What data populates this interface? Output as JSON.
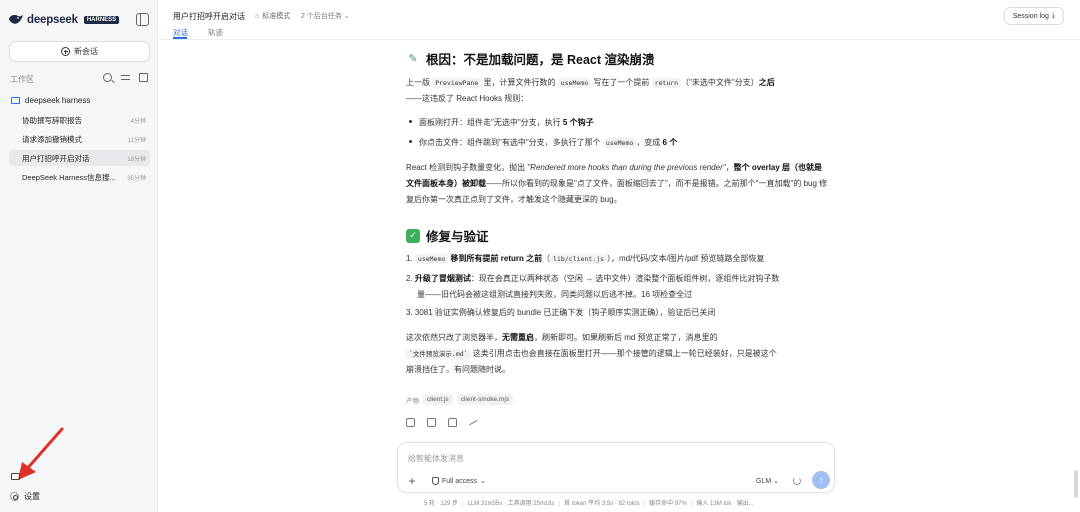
{
  "sidebar": {
    "logo_text": "deepseek",
    "logo_badge": "HARNESS",
    "new_chat_label": "新会话",
    "workspace_label": "工作区",
    "folder_name": "deepseek harness",
    "sessions": [
      {
        "title": "协助撰写辞职报告",
        "time": "4分钟"
      },
      {
        "title": "请求添加撤销模式",
        "time": "11分钟"
      },
      {
        "title": "用户打招呼开启对话",
        "time": "18分钟"
      },
      {
        "title": "DeepSeek Harness信息搜...",
        "time": "35分钟"
      }
    ],
    "active_session_index": 2,
    "settings_label": "设置"
  },
  "header": {
    "title": "用户打招呼开启对话",
    "mode": "标准模式",
    "tasks": "2 个后台任务",
    "tabs": [
      "对话",
      "轨迹"
    ],
    "session_log": "Session log"
  },
  "content": {
    "h_root": "根因：不是加载问题，是 React 渲染崩溃",
    "p1": {
      "a": "上一版 ",
      "c1": "PreviewPane",
      "b": " 里，计算文件行数的 ",
      "c2": "useMemo",
      "c": " 写在了一个提前 ",
      "c3": "return",
      "d": "（\"未选中文件\"分支）",
      "e": "之后",
      "f": "——这违反了 React Hooks 规则："
    },
    "bullets": {
      "b1_text": "面板刚打开：组件走\"无选中\"分支，执行 ",
      "b1_bold": "5 个钩子",
      "b2_text": "你点击文件：组件跳到\"有选中\"分支，多执行了那个 ",
      "b2_code": "useMemo",
      "b2_mid": "，变成 ",
      "b2_bold": "6 个"
    },
    "p2": {
      "a": "React 检测到钩子数量变化，抛出 ",
      "italic": "\"Rendered more hooks than during the previous render\"",
      "b": "，",
      "bold1": "整个 overlay 层（也就是文件面板本身）被卸载",
      "c": "——所以你看到的现象是\"点了文件，面板缩回去了\"，而不是报错。之前那个\"一直加载\"的 bug 修复后你第一次真正点到了文件，才触发这个隐藏更深的 bug。"
    },
    "h_fix": "修复与验证",
    "fix": {
      "n1": "1.",
      "i1_code": "useMemo",
      "i1_bold": " 移到所有提前 return 之前",
      "i1_a": "（",
      "i1_code2": "lib/client.js",
      "i1_b": "），md/代码/文本/图片/pdf 预览链路全部恢复",
      "n2": "2.",
      "i2_bold": "升级了冒烟测试",
      "i2_a": "：现在会真正以两种状态（空闲 → 选中文件）渲染整个面板组件树，逐组件比对钩子数",
      "i2_b": "量——旧代码会被这组测试直接判失败，同类问题以后逃不掉。16 项检查全过",
      "n3": "3.",
      "i3": "3081 验证实例确认修复后的 bundle 已正确下发（钩子顺序实测正确），验证后已关闭"
    },
    "p3": {
      "a": "这次依然只改了浏览器半，",
      "bold": "无需重启",
      "b": "，刷新即可。如果刷新后 md 预览正常了，消息里的",
      "code": "`文件预览演示.md`",
      "c": " 这类引用点击也会直接在面板里打开——那个接管的逻辑上一轮已经装好，只是被这个",
      "d": "崩溃挡住了。有问题随时说。"
    },
    "tags_label": "产物",
    "tags": [
      "client.js",
      "client-smoke.mjs"
    ]
  },
  "composer": {
    "placeholder": "给智能体发消息",
    "access": "Full access",
    "model": "GLM",
    "send_icon": "↑"
  },
  "status_bar": [
    "5 轮 · 129 步",
    "LLM 31m55s · 工具调用 25m18s",
    "首 token 平均 3.5s · 82 tok/s",
    "缓存命中 97%",
    "输入 13M tok · 输出..."
  ],
  "colors": {
    "accent": "#2b6fe8",
    "annotation_arrow": "#e0302a"
  }
}
